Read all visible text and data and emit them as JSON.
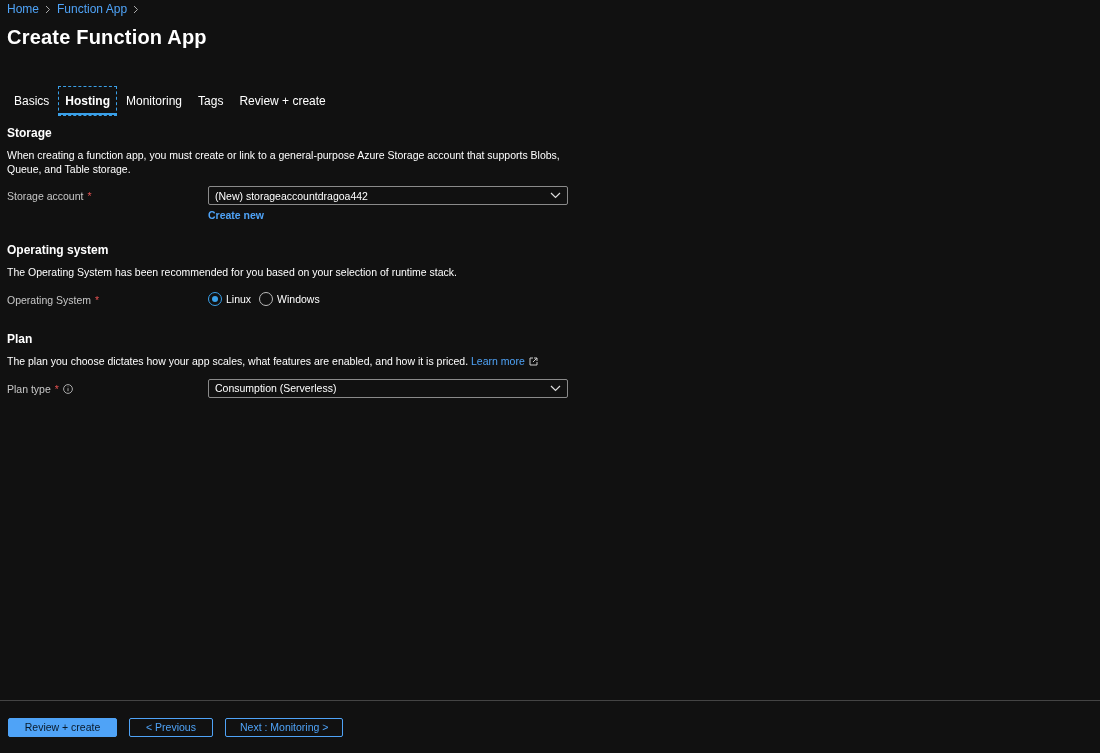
{
  "breadcrumb": [
    "Home",
    "Function App"
  ],
  "title": "Create Function App",
  "tabs": [
    {
      "label": "Basics",
      "selected": false
    },
    {
      "label": "Hosting",
      "selected": true
    },
    {
      "label": "Monitoring",
      "selected": false
    },
    {
      "label": "Tags",
      "selected": false
    },
    {
      "label": "Review + create",
      "selected": false
    }
  ],
  "sections": [
    {
      "heading": "Storage",
      "description": "When creating a function app, you must create or link to a general-purpose Azure Storage account that supports Blobs, Queue, and Table storage.",
      "fields": [
        {
          "kind": "dropdown",
          "label": "Storage account",
          "required_mark": "*",
          "value": "(New) storageaccountdragoa442",
          "link": "Create new"
        }
      ]
    },
    {
      "heading": "Operating system",
      "description": "The Operating System has been recommended for you based on your selection of runtime stack.",
      "fields": [
        {
          "kind": "radio",
          "label": "Operating System",
          "required_mark": "*",
          "options": [
            {
              "label": "Linux",
              "selected": true
            },
            {
              "label": "Windows",
              "selected": false
            }
          ]
        }
      ]
    },
    {
      "heading": "Plan",
      "description": "The plan you choose dictates how your app scales, what features are enabled, and how it is priced.",
      "learn_more": "Learn more",
      "fields": [
        {
          "kind": "dropdown",
          "label": "Plan type",
          "required_mark": "*",
          "info": true,
          "value": "Consumption (Serverless)"
        }
      ]
    }
  ],
  "footer_buttons": [
    {
      "label": "Review + create",
      "kind": "primary"
    },
    {
      "label": "< Previous",
      "kind": "secondary"
    },
    {
      "label": "Next : Monitoring >",
      "kind": "secondary"
    }
  ]
}
